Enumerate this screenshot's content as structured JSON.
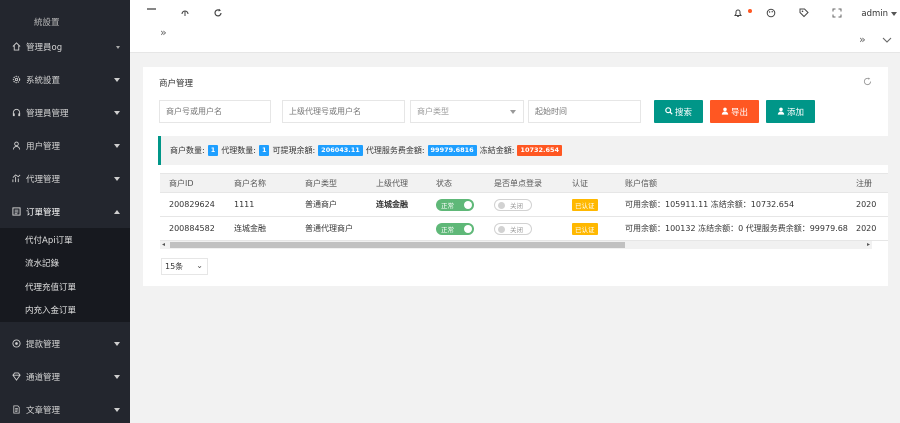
{
  "sidebar": {
    "top_partial": "統設置",
    "items_before": [
      {
        "label": "管理員og",
        "icon": "home-icon"
      },
      {
        "label": "系統設置",
        "icon": "gear-icon"
      },
      {
        "label": "管理員管理",
        "icon": "headset-icon"
      },
      {
        "label": "用户管理",
        "icon": "user-icon"
      },
      {
        "label": "代理管理",
        "icon": "chart-icon"
      },
      {
        "label": "订單管理",
        "icon": "list-icon"
      }
    ],
    "subitems": [
      "代付Api订單",
      "流水記錄",
      "代理充值订單",
      "内充入金订單"
    ],
    "items_after": [
      {
        "label": "提款管理",
        "icon": "coin-icon"
      },
      {
        "label": "通道管理",
        "icon": "diamond-icon"
      },
      {
        "label": "文章管理",
        "icon": "doc-icon"
      }
    ]
  },
  "topbar": {
    "user": "admin"
  },
  "page": {
    "title": "商户管理",
    "filters": {
      "merchant_placeholder": "商户号或用户名",
      "agent_placeholder": "上级代理号或用户名",
      "type_placeholder": "商户类型",
      "time_placeholder": "起始时间"
    },
    "buttons": {
      "search": "搜索",
      "export": "导出",
      "add": "添加"
    },
    "colors": {
      "search": "#009688",
      "export": "#FF5722",
      "add": "#009688",
      "badge_blue": "#1E9FFF",
      "badge_red": "#FF5722"
    },
    "stats": {
      "merchant_count_label": "商户数量:",
      "merchant_count": "1",
      "agent_count_label": "代理数量:",
      "agent_count": "1",
      "available_label": "可提現余額:",
      "available": "206043.11",
      "agent_fee_label": "代理服务费金額:",
      "agent_fee": "99979.6816",
      "frozen_label": "冻結金額:",
      "frozen": "10732.654"
    },
    "table": {
      "headers": [
        "商户ID",
        "商户名称",
        "商户类型",
        "上级代理",
        "状态",
        "是否单点登录",
        "认证",
        "账户信额",
        "注册"
      ],
      "rows": [
        {
          "id": "200829624",
          "name": "1111",
          "type": "普通商户",
          "agent": "连城金融",
          "status": "正常",
          "sso": "关闭",
          "auth": "已认证",
          "balance": "可用余额：105911.11 冻结余额：10732.654",
          "reg": "2020"
        },
        {
          "id": "200884582",
          "name": "连城金融",
          "type": "普通代理商户",
          "agent": "",
          "status": "正常",
          "sso": "关闭",
          "auth": "已认证",
          "balance": "可用余额：100132 冻结余额：0 代理服务费余额：99979.68",
          "reg": "2020"
        }
      ]
    },
    "page_size": "15条"
  }
}
